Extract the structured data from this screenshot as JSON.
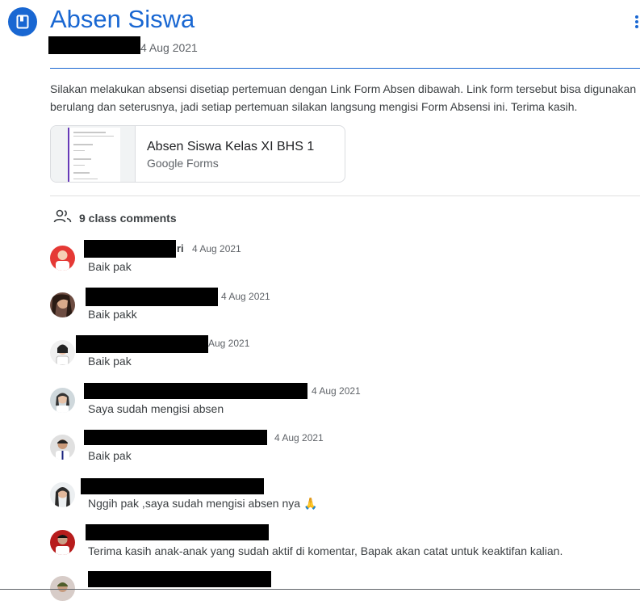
{
  "header": {
    "title": "Absen Siswa",
    "date_fragment": "4 Aug 2021",
    "icon": "assignment-icon",
    "menu_icon": "more-vert-icon",
    "accent_color": "#1967d2"
  },
  "description": "Silakan melakukan absensi disetiap pertemuan dengan Link Form Absen dibawah.  Link form tersebut bisa digunakan berulang dan seterusnya, jadi setiap pertemuan silakan langsung mengisi Form Absensi ini. Terima kasih.",
  "attachment": {
    "name": "Absen Siswa Kelas XI BHS 1",
    "type": "Google Forms",
    "icon": "google-forms-thumbnail"
  },
  "comments_section": {
    "icon": "people-icon",
    "count_label": "9 class comments"
  },
  "comments": [
    {
      "name_fragment": "ri",
      "date": "4 Aug 2021",
      "text": "Baik pak"
    },
    {
      "name_fragment": "",
      "date": "4 Aug 2021",
      "text": "Baik pakk"
    },
    {
      "name_fragment": "",
      "date": "Aug 2021",
      "text": "Baik pak"
    },
    {
      "name_fragment": "",
      "date": "4 Aug 2021",
      "text": "Saya sudah mengisi absen"
    },
    {
      "name_fragment": "",
      "date": "4 Aug 2021",
      "text": "Baik pak"
    },
    {
      "name_fragment": "",
      "date": "",
      "text": "Nggih pak ,saya sudah mengisi absen nya 🙏"
    },
    {
      "name_fragment": "",
      "date": "",
      "text": "Terima kasih anak-anak yang sudah aktif di komentar, Bapak akan catat untuk keaktifan kalian."
    },
    {
      "name_fragment": "",
      "date": "",
      "text": ""
    }
  ]
}
